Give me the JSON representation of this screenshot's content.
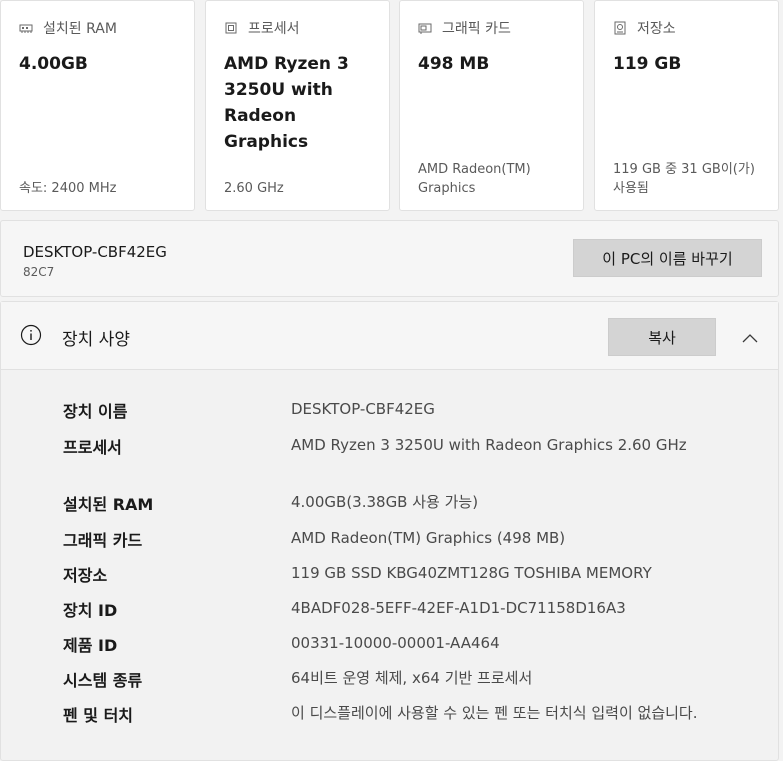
{
  "cards": [
    {
      "icon": "ram-icon",
      "title": "설치된 RAM",
      "value": "4.00GB",
      "foot": "속도: 2400 MHz"
    },
    {
      "icon": "processor-icon",
      "title": "프로세서",
      "value": "AMD Ryzen 3 3250U with Radeon Graphics",
      "foot": "2.60 GHz"
    },
    {
      "icon": "graphics-card-icon",
      "title": "그래픽 카드",
      "value": "498 MB",
      "foot": "AMD Radeon(TM) Graphics"
    },
    {
      "icon": "storage-icon",
      "title": "저장소",
      "value": "119 GB",
      "foot": "119 GB 중 31 GB이(가) 사용됨"
    }
  ],
  "device": {
    "name": "DESKTOP-CBF42EG",
    "model": "82C7",
    "rename_label": "이 PC의 이름 바꾸기"
  },
  "specs": {
    "title": "장치 사양",
    "copy_label": "복사",
    "rows": [
      {
        "label": "장치 이름",
        "value": "DESKTOP-CBF42EG"
      },
      {
        "label": "프로세서",
        "value": "AMD Ryzen 3 3250U with Radeon Graphics 2.60 GHz"
      },
      {
        "label": "설치된 RAM",
        "value": "4.00GB(3.38GB 사용 가능)"
      },
      {
        "label": "그래픽 카드",
        "value": "AMD Radeon(TM) Graphics (498 MB)"
      },
      {
        "label": "저장소",
        "value": "119 GB SSD KBG40ZMT128G TOSHIBA MEMORY"
      },
      {
        "label": "장치 ID",
        "value": "4BADF028-5EFF-42EF-A1D1-DC71158D16A3"
      },
      {
        "label": "제품 ID",
        "value": "00331-10000-00001-AA464"
      },
      {
        "label": "시스템 종류",
        "value": "64비트 운영 체제, x64 기반 프로세서"
      },
      {
        "label": "펜 및 터치",
        "value": "이 디스플레이에 사용할 수 있는 펜 또는 터치식 입력이 없습니다."
      }
    ]
  }
}
